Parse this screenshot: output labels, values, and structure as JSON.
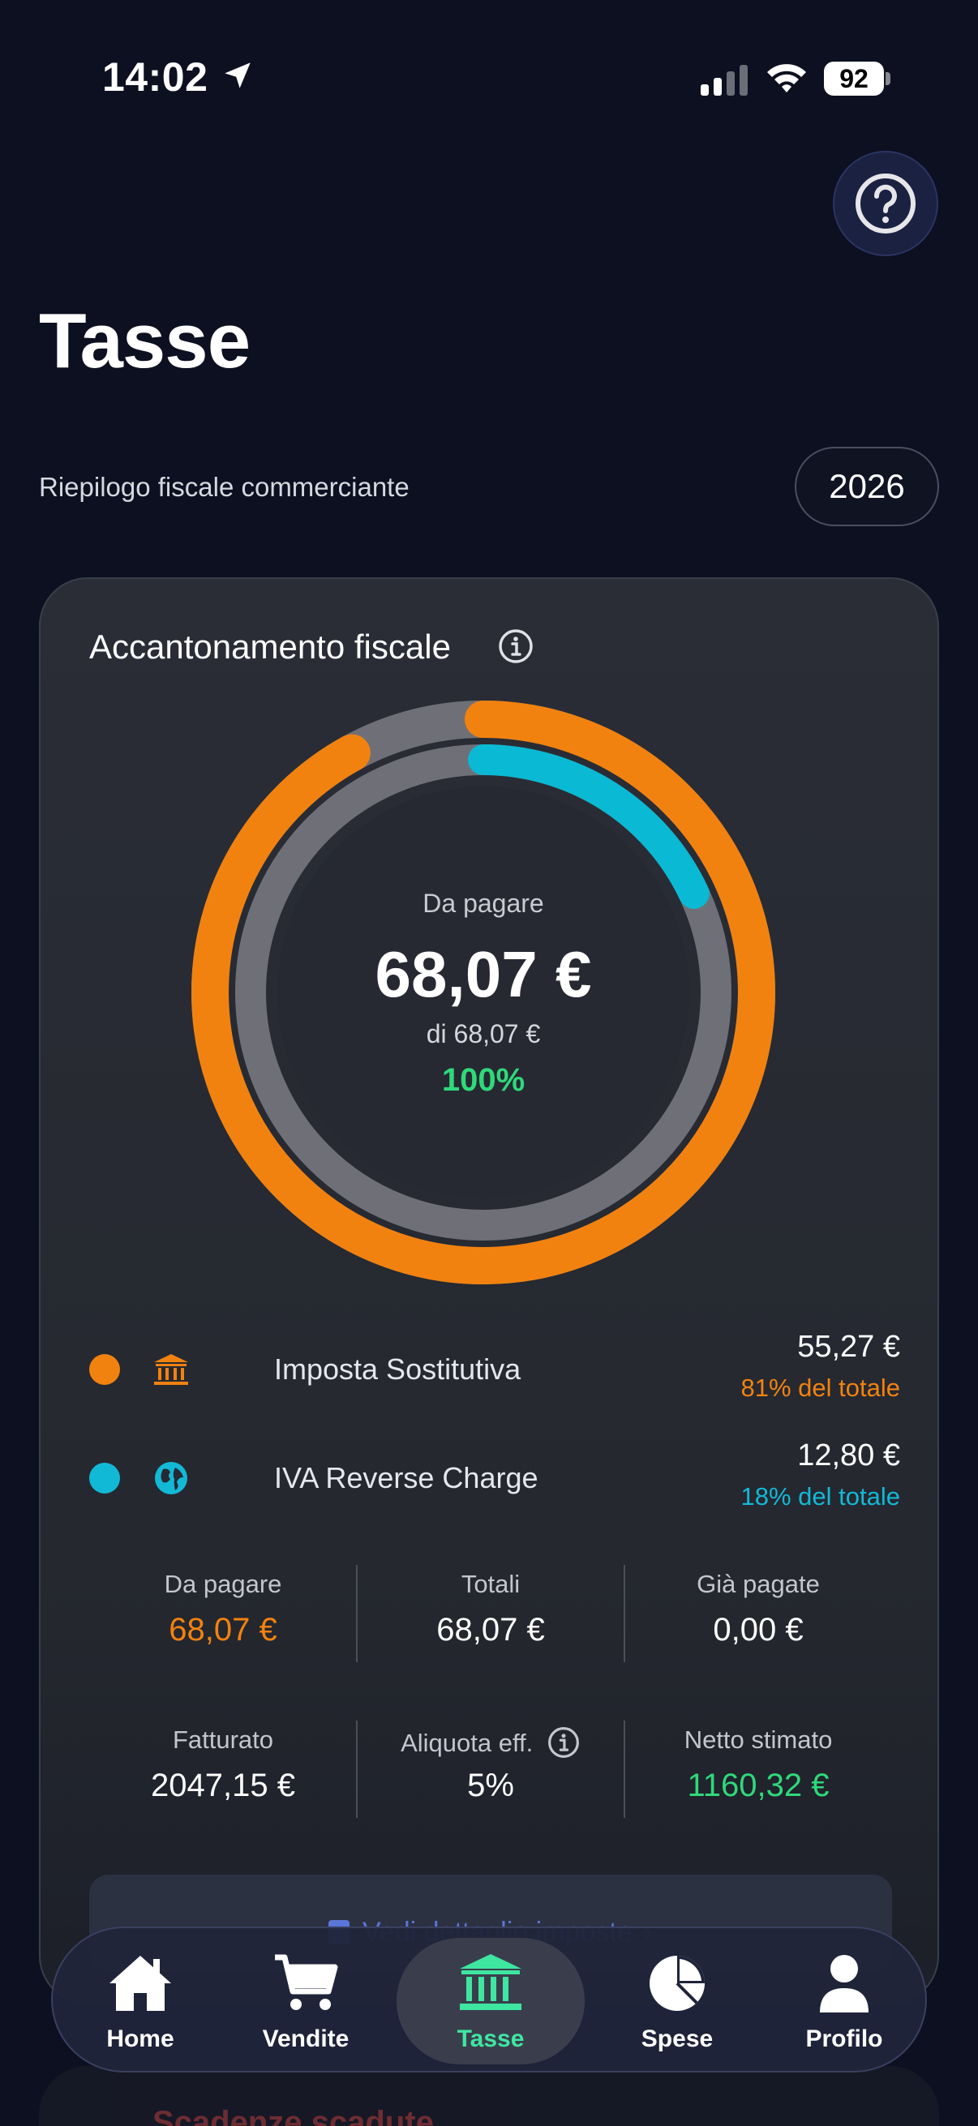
{
  "status_bar": {
    "time": "14:02",
    "battery": "92"
  },
  "header": {
    "title": "Tasse",
    "subtitle": "Riepilogo fiscale commerciante",
    "year": "2026"
  },
  "card": {
    "title": "Accantonamento fiscale",
    "donut": {
      "label": "Da pagare",
      "amount": "68,07 €",
      "of_total": "di 68,07 €",
      "percent": "100%",
      "outer_fraction": 1.0,
      "inner_fraction": 0.18,
      "colors": {
        "outer": "#f2820f",
        "inner": "#0ab9d4",
        "track": "#6f7077"
      }
    },
    "legend": [
      {
        "icon": "bank-icon",
        "label": "Imposta Sostitutiva",
        "amount": "55,27 €",
        "share": "81% del totale",
        "color": "#f2820f"
      },
      {
        "icon": "globe-icon",
        "label": "IVA Reverse Charge",
        "amount": "12,80 €",
        "share": "18% del totale",
        "color": "#12b9d6"
      }
    ],
    "stats_row1": [
      {
        "label": "Da pagare",
        "value": "68,07 €",
        "color": "#f2820f"
      },
      {
        "label": "Totali",
        "value": "68,07 €",
        "color": "#ffffff"
      },
      {
        "label": "Già pagate",
        "value": "0,00 €",
        "color": "#ffffff"
      }
    ],
    "stats_row2": [
      {
        "label": "Fatturato",
        "value": "2047,15 €",
        "color": "#ffffff"
      },
      {
        "label": "Aliquota eff.",
        "value": "5%",
        "color": "#ffffff"
      },
      {
        "label": "Netto stimato",
        "value": "1160,32 €",
        "color": "#2fd97a"
      }
    ],
    "detail_button": "Vedi dettaglio imposte"
  },
  "below_card": {
    "title": "Scadenze scadute"
  },
  "tabbar": {
    "tabs": [
      {
        "label": "Home",
        "icon": "home-icon"
      },
      {
        "label": "Vendite",
        "icon": "cart-icon"
      },
      {
        "label": "Tasse",
        "icon": "bank-icon",
        "active": true
      },
      {
        "label": "Spese",
        "icon": "pie-chart-icon"
      },
      {
        "label": "Profilo",
        "icon": "person-icon"
      }
    ]
  }
}
